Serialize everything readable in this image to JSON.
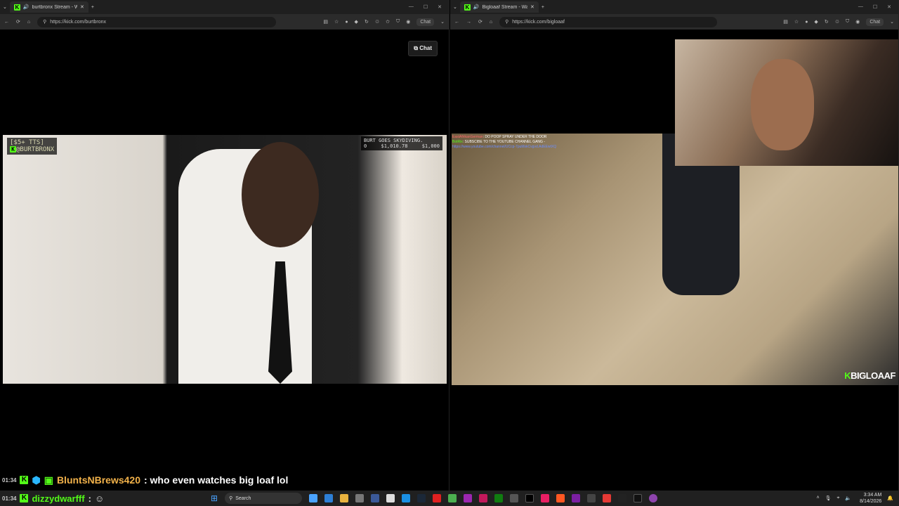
{
  "left_window": {
    "tab_title": "burtbronx Stream - Watch Live",
    "url": "https://kick.com/burtbronx",
    "chat_pill": "Chat",
    "chat_button": "Chat",
    "overlay_tts": "[$5+ TTS]",
    "overlay_handle": "@BURTBRONX",
    "overlay_goal_title": "BURT GOES SKYDIVING.",
    "overlay_goal_current": "$1,010.78",
    "overlay_goal_target": "$1,000",
    "overlay_goal_left": "0"
  },
  "right_window": {
    "tab_title": "Bigloaaf Stream - Watch Live",
    "url": "https://kick.com/bigloaaf",
    "chat_pill": "Chat",
    "chat": [
      {
        "user": "EastAfrikanGerman",
        "text": ": DO POOP SPRAY UNDER THE DOOR"
      },
      {
        "user": "BotRix",
        "text": ": SUBSCIBE TO THE YOUTUBE CHANNEL GANG -"
      },
      {
        "user": "",
        "text": "https://www.youtube.com/channel/UCcp-7puMskCvgvd.AdEEwtXQ"
      }
    ],
    "watermark": "BIGLOAAF"
  },
  "ticker": {
    "time": "01:34",
    "user": "BluntsNBrews420",
    "message": ": who even watches big loaf lol"
  },
  "taskbar": {
    "time_left": "01:34",
    "user": "dizzydwarfff",
    "sep": ":",
    "search": "Search",
    "clock_time": "3:34 AM",
    "clock_date": "8/14/2026"
  }
}
